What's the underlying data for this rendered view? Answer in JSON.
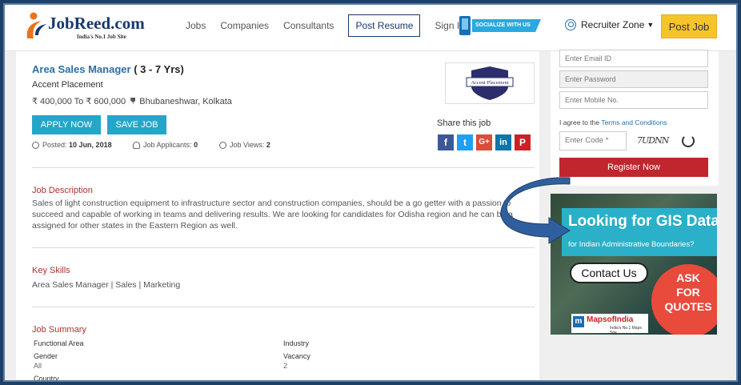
{
  "header": {
    "brand_name": "JobReed.com",
    "brand_tagline": "India's No.1 Job Site",
    "nav": [
      "Jobs",
      "Companies",
      "Consultants",
      "Post Resume",
      "Sign In"
    ],
    "social_label": "SOCIALIZE WITH US",
    "recruiter_zone": "Recruiter Zone",
    "post_job": "Post Job"
  },
  "job": {
    "title": "Area Sales Manager",
    "experience": "( 3 - 7 Yrs)",
    "company": "Accent Placement",
    "salary": "₹ 400,000 To ₹ 600,000",
    "location": "Bhubaneshwar,  Kolkata",
    "apply_label": "APPLY NOW",
    "save_label": "SAVE JOB",
    "posted_label": "Posted:",
    "posted_date": "10 Jun, 2018",
    "applicants_label": "Job Applicants:",
    "applicants_count": "0",
    "views_label": "Job Views:",
    "views_count": "2",
    "company_logo_text": "Accent Placement",
    "share_label": "Share this job",
    "share_icons": [
      "facebook-icon",
      "twitter-icon",
      "google-plus-icon",
      "linkedin-icon",
      "pinterest-icon"
    ]
  },
  "description": {
    "title": "Job Description",
    "text": "Sales of light construction equipment to infrastructure sector and construction companies, should be a go getter with a passion to succeed and capable of working in teams and delivering results. We are looking for candidates for Odisha region and he can be a assigned for other states in the Eastern Region as well."
  },
  "skills": {
    "title": "Key Skills",
    "text": "Area Sales Manager | Sales | Marketing"
  },
  "summary": {
    "title": "Job Summary",
    "items": [
      {
        "label": "Functional Area",
        "value": ""
      },
      {
        "label": "Industry",
        "value": ""
      },
      {
        "label": "Gender",
        "value": "All"
      },
      {
        "label": "Vacancy",
        "value": "2"
      },
      {
        "label": "Country",
        "value": ""
      }
    ]
  },
  "register": {
    "email_placeholder": "Enter Email ID",
    "password_placeholder": "Enter Password",
    "mobile_placeholder": "Enter Mobile No.",
    "agree_text": "I agree to the",
    "terms_link": "Terms and Conditions",
    "code_placeholder": "Enter Code *",
    "captcha": "7UDNN",
    "button": "Register Now"
  },
  "ad": {
    "headline": "Looking for GIS Data",
    "subline": "for Indian Administrative Boundaries?",
    "contact": "Contact Us",
    "quote_line1": "ASK",
    "quote_line2": "FOR",
    "quote_line3": "QUOTES",
    "brand": "MapsofIndia",
    "brand_tag": "India's No.1 Maps Site"
  },
  "colors": {
    "brand": "#17386b",
    "accent": "#25a6c9",
    "register": "#c0262d",
    "post_job": "#f5c42a",
    "section_title": "#b03030"
  }
}
